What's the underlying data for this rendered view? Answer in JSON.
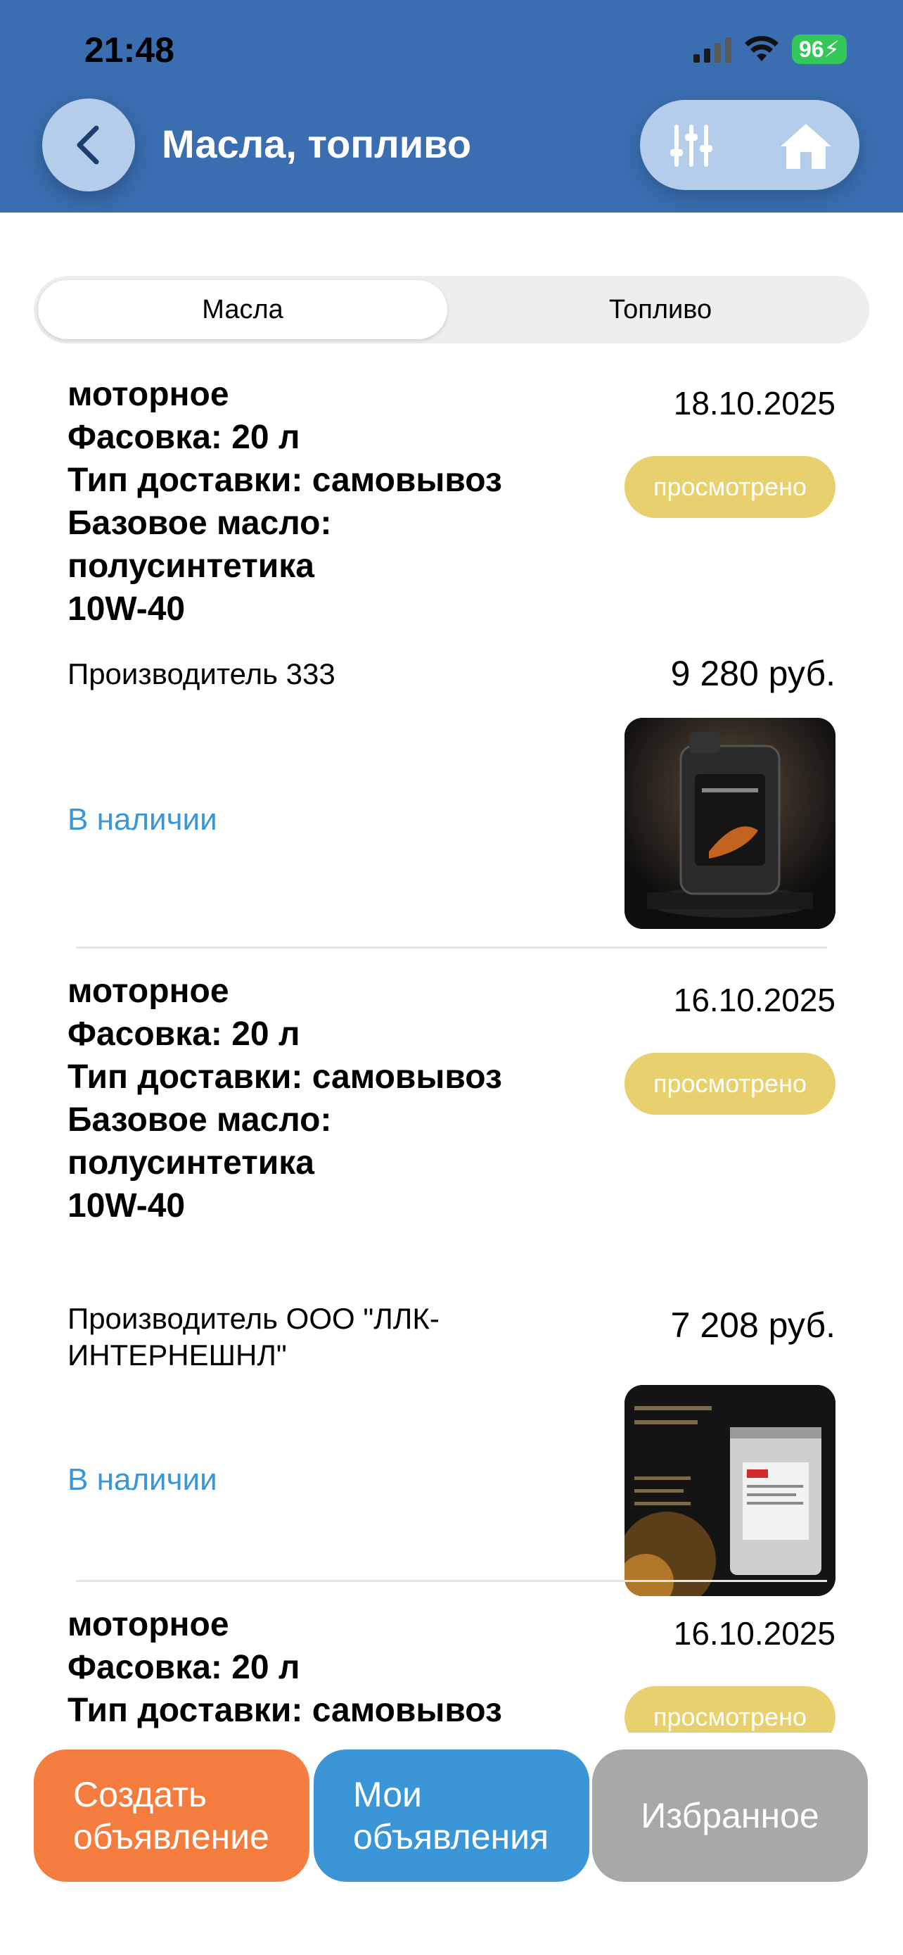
{
  "status_bar": {
    "time": "21:48",
    "battery": "96"
  },
  "header": {
    "title": "Масла, топливо"
  },
  "tabs": [
    {
      "label": "Масла",
      "active": true
    },
    {
      "label": "Топливо",
      "active": false
    }
  ],
  "listings": [
    {
      "description": "моторное\nФасовка: 20 л\nТип доставки: самовывоз\nБазовое масло:\nполусинтетика\n10W-40",
      "date": "18.10.2025",
      "status": "просмотрено",
      "manufacturer": "Производитель 333",
      "price": "9 280 руб.",
      "availability": "В наличии"
    },
    {
      "description": "моторное\nФасовка: 20 л\nТип доставки: самовывоз\nБазовое масло:\nполусинтетика\n10W-40",
      "date": "16.10.2025",
      "status": "просмотрено",
      "manufacturer": "Производитель ООО \"ЛЛК-ИНТЕРНЕШНЛ\"",
      "price": "7 208 руб.",
      "availability": "В наличии"
    },
    {
      "description": "моторное\nФасовка: 20 л\nТип доставки: самовывоз",
      "date": "16.10.2025",
      "status": "просмотрено"
    }
  ],
  "bottom_buttons": {
    "create": "Создать\nобъявление",
    "mine": "Мои\nобъявления",
    "favorites": "Избранное"
  },
  "colors": {
    "header": "#3a6eb0",
    "badge": "#e8d06e",
    "availability": "#3a96d6",
    "create_button": "#f47c3e",
    "mine_button": "#3a96d6",
    "favorites_button": "#a8a8a8"
  }
}
